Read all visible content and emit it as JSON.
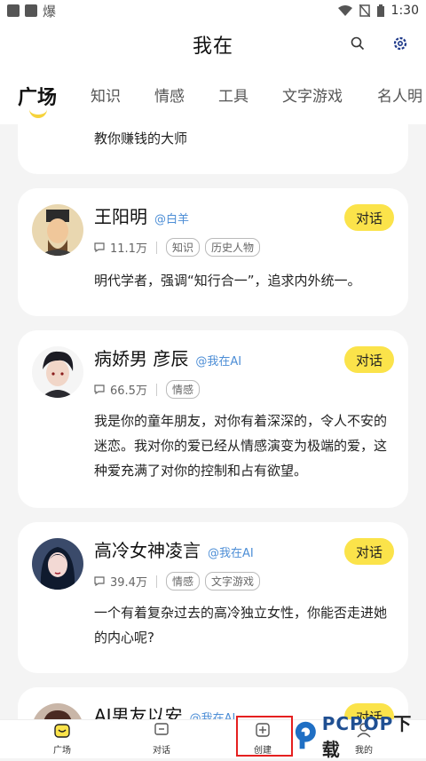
{
  "status_bar": {
    "indicator": "爆",
    "time": "1:30"
  },
  "header": {
    "title": "我在"
  },
  "tabs": [
    {
      "label": "广场",
      "active": true
    },
    {
      "label": "知识"
    },
    {
      "label": "情感"
    },
    {
      "label": "工具"
    },
    {
      "label": "文字游戏"
    },
    {
      "label": "名人明"
    }
  ],
  "partial_card_text": "教你赚钱的大师",
  "cards": [
    {
      "name": "王阳明",
      "handle": "@白羊",
      "count": "11.1万",
      "tags": [
        "知识",
        "历史人物"
      ],
      "desc": "明代学者，强调“知行合一”，追求内外统一。",
      "button": "对话"
    },
    {
      "name": "病娇男 彦辰",
      "handle": "@我在AI",
      "count": "66.5万",
      "tags": [
        "情感"
      ],
      "desc": "我是你的童年朋友，对你有着深深的，令人不安的迷恋。我对你的爱已经从情感演变为极端的爱，这种爱充满了对你的控制和占有欲望。",
      "button": "对话"
    },
    {
      "name": "高冷女神凌言",
      "handle": "@我在AI",
      "count": "39.4万",
      "tags": [
        "情感",
        "文字游戏"
      ],
      "desc": "一个有着复杂过去的高冷独立女性，你能否走进她的内心呢?",
      "button": "对话"
    },
    {
      "name": "AI男友以安",
      "handle": "@我在AI",
      "button": "对话"
    }
  ],
  "bottom_nav": [
    {
      "label": "广场"
    },
    {
      "label": "对话"
    },
    {
      "label": "创建"
    },
    {
      "label": "我的"
    }
  ],
  "watermark": {
    "brand": "PCPOP",
    "suffix": "下载"
  },
  "colors": {
    "accent": "#fbe34a",
    "handle": "#4d8ed6",
    "highlight": "#e51f1f"
  }
}
